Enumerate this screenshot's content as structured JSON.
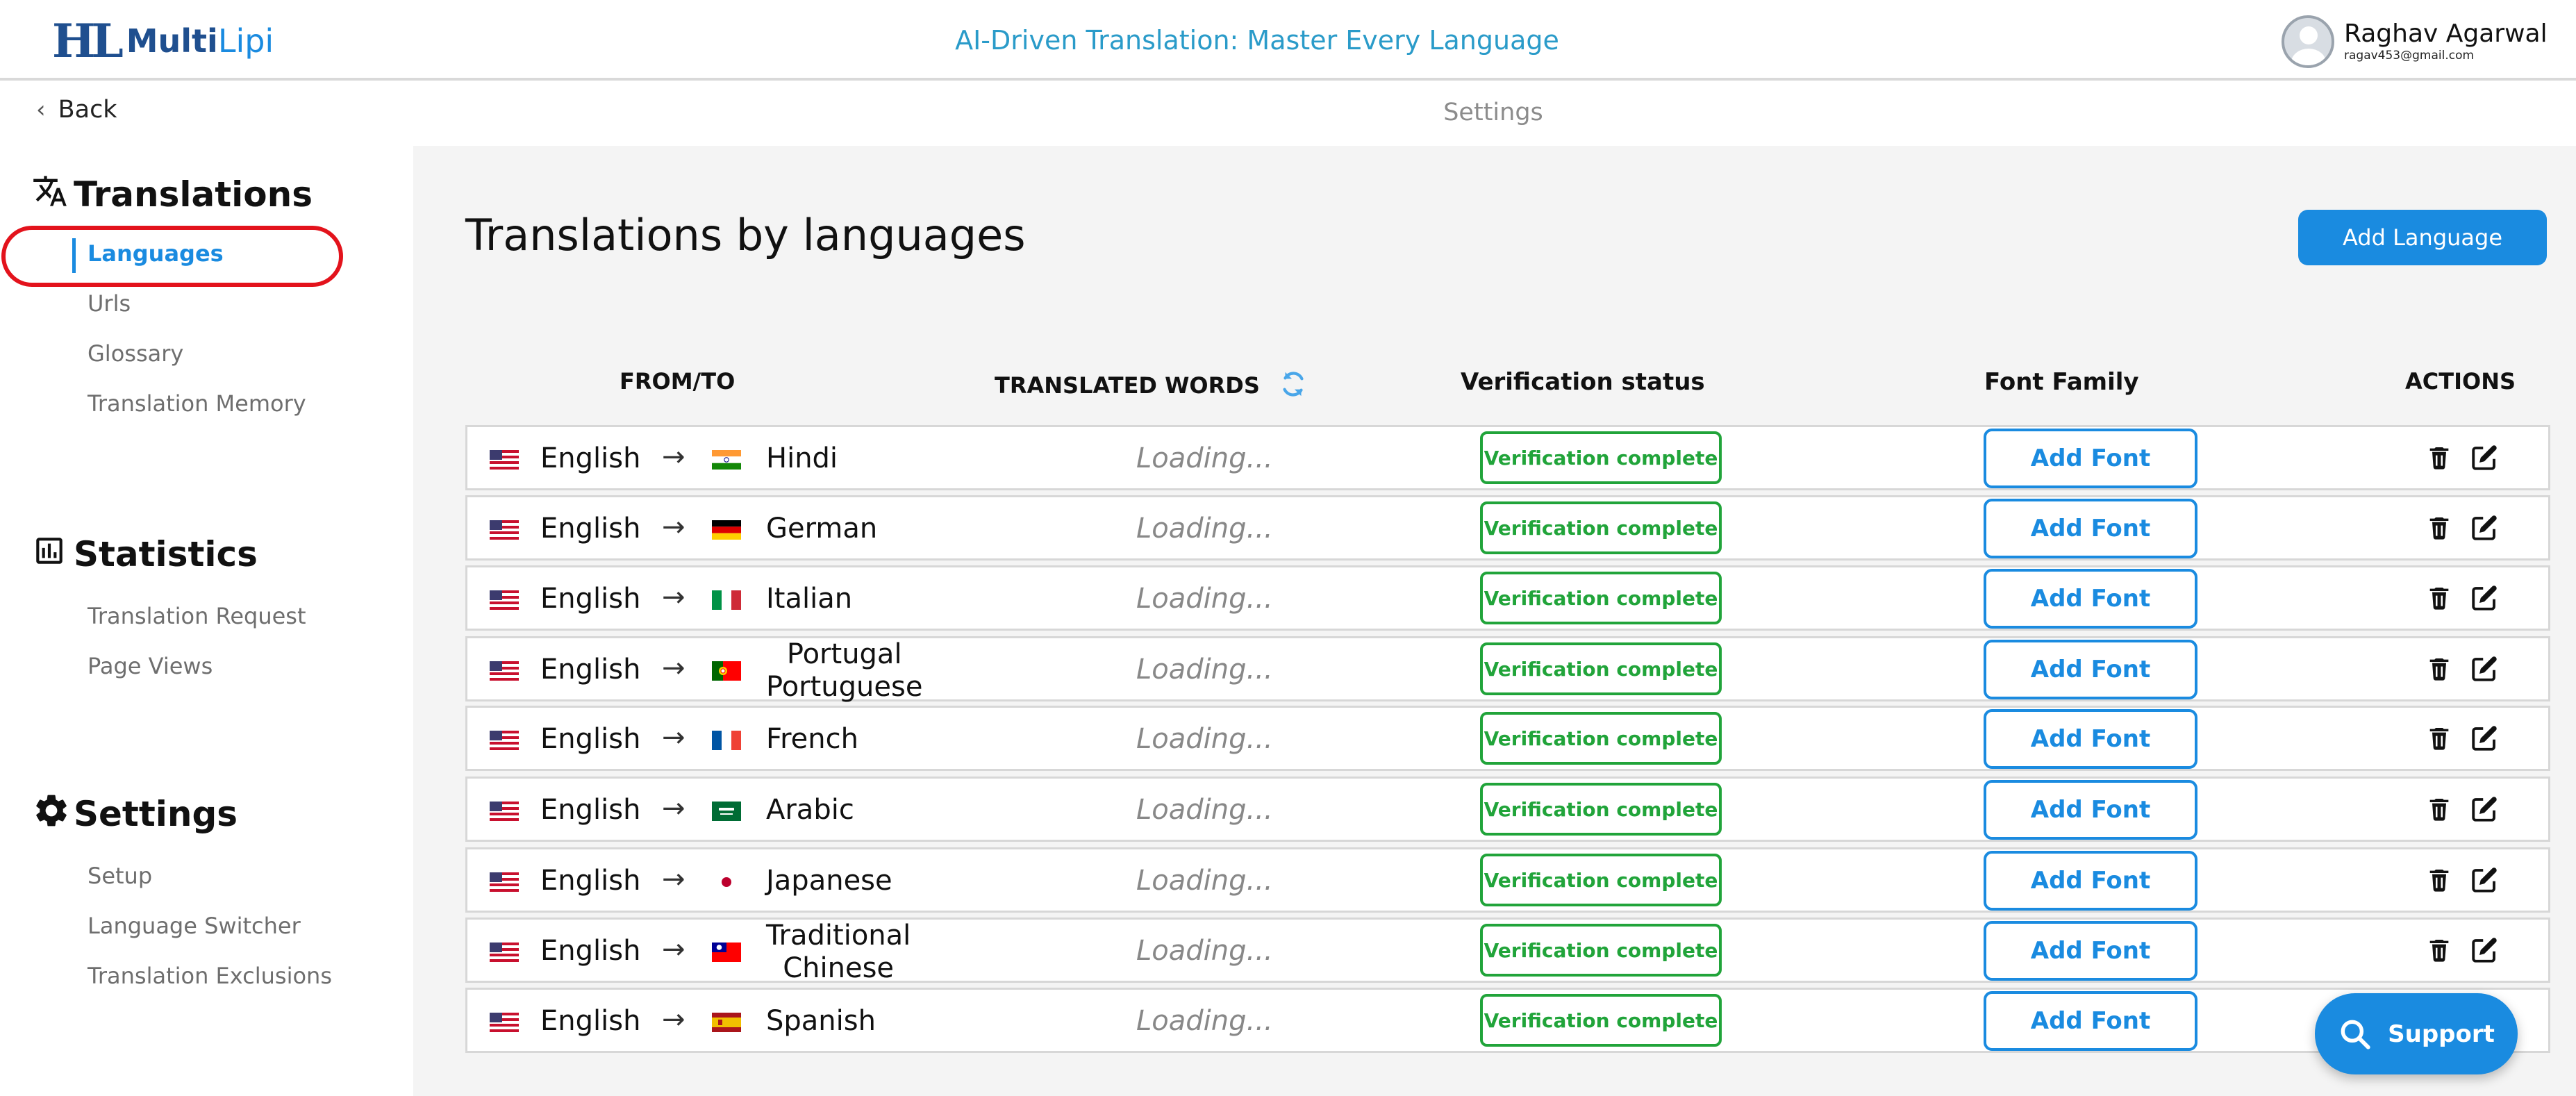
{
  "header": {
    "logo_mark": "HL",
    "logo_multi": "Multi",
    "logo_lipi": "Lipi",
    "tagline": "AI-Driven Translation: Master Every Language",
    "user_name": "Raghav Agarwal",
    "user_email": "ragav453@gmail.com"
  },
  "nav": {
    "back_label": "Back",
    "page_label": "Settings"
  },
  "sidebar": {
    "sections": [
      {
        "title": "Translations",
        "icon": "translate-icon",
        "items": [
          "Languages",
          "Urls",
          "Glossary",
          "Translation Memory"
        ]
      },
      {
        "title": "Statistics",
        "icon": "bar-chart-icon",
        "items": [
          "Translation Request",
          "Page Views"
        ]
      },
      {
        "title": "Settings",
        "icon": "gear-icon",
        "items": [
          "Setup",
          "Language Switcher",
          "Translation Exclusions"
        ]
      }
    ],
    "active_item": "Languages"
  },
  "main": {
    "title": "Translations by languages",
    "add_language_label": "Add Language",
    "columns": {
      "from_to": "FROM/TO",
      "translated_words": "TRANSLATED WORDS",
      "verification": "Verification status",
      "font_family": "Font Family",
      "actions": "ACTIONS"
    },
    "rows": [
      {
        "from": "English",
        "to": "Hindi",
        "to_line2": "",
        "words": "Loading...",
        "status": "Verification complete",
        "font_label": "Add Font"
      },
      {
        "from": "English",
        "to": "German",
        "to_line2": "",
        "words": "Loading...",
        "status": "Verification complete",
        "font_label": "Add Font"
      },
      {
        "from": "English",
        "to": "Italian",
        "to_line2": "",
        "words": "Loading...",
        "status": "Verification complete",
        "font_label": "Add Font"
      },
      {
        "from": "English",
        "to": "Portugal",
        "to_line2": "Portuguese",
        "words": "Loading...",
        "status": "Verification complete",
        "font_label": "Add Font"
      },
      {
        "from": "English",
        "to": "French",
        "to_line2": "",
        "words": "Loading...",
        "status": "Verification complete",
        "font_label": "Add Font"
      },
      {
        "from": "English",
        "to": "Arabic",
        "to_line2": "",
        "words": "Loading...",
        "status": "Verification complete",
        "font_label": "Add Font"
      },
      {
        "from": "English",
        "to": "Japanese",
        "to_line2": "",
        "words": "Loading...",
        "status": "Verification complete",
        "font_label": "Add Font"
      },
      {
        "from": "English",
        "to": "Traditional",
        "to_line2": "Chinese",
        "words": "Loading...",
        "status": "Verification complete",
        "font_label": "Add Font"
      },
      {
        "from": "English",
        "to": "Spanish",
        "to_line2": "",
        "words": "Loading...",
        "status": "Verification complete",
        "font_label": "Add Font"
      }
    ]
  },
  "support_label": "Support",
  "colors": {
    "accent": "#1a8be0",
    "success": "#21a43a",
    "highlight_ring": "#e3131c",
    "tagline": "#2a9bc9"
  }
}
